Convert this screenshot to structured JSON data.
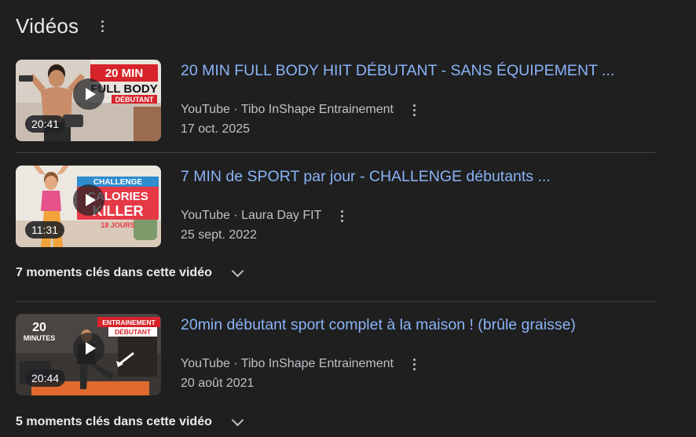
{
  "header": {
    "title": "Vidéos"
  },
  "videos": [
    {
      "title": "20 MIN FULL BODY HIIT DÉBUTANT - SANS ÉQUIPEMENT ...",
      "duration": "20:41",
      "source": "YouTube · Tibo InShape Entrainement",
      "date": "17 oct. 2025",
      "thumb_text": [
        "20 MIN",
        "FULL BODY",
        "DÉBUTANT"
      ]
    },
    {
      "title": "7 MIN de SPORT par jour - CHALLENGE débutants ...",
      "duration": "11:31",
      "source": "YouTube · Laura Day FIT",
      "date": "25 sept. 2022",
      "thumb_text": [
        "CHALLENGE",
        "CALORIES",
        "KILLER",
        "18 JOURS"
      ],
      "moments": "7 moments clés dans cette vidéo"
    },
    {
      "title": "20min débutant sport complet à la maison ! (brûle graisse)",
      "duration": "20:44",
      "source": "YouTube · Tibo InShape Entrainement",
      "date": "20 août 2021",
      "thumb_text": [
        "20",
        "MINUTES",
        "ENTRAINEMENT",
        "DÉBUTANT"
      ],
      "moments": "5 moments clés dans cette vidéo"
    }
  ],
  "colors": {
    "background": "#1f1f1f",
    "link": "#8ab4f8",
    "secondary_text": "#bdc1c6",
    "divider": "#3c4043"
  }
}
